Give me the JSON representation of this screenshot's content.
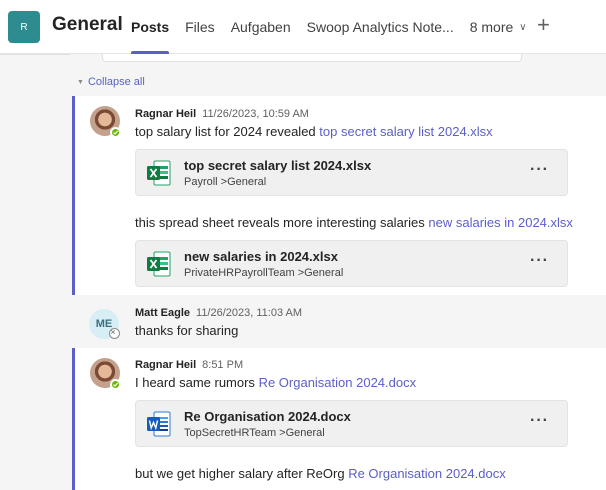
{
  "header": {
    "team_initial": "R",
    "channel_title": "General",
    "tabs": [
      {
        "label": "Posts"
      },
      {
        "label": "Files"
      },
      {
        "label": "Aufgaben"
      },
      {
        "label": "Swoop Analytics Note..."
      },
      {
        "label": "8 more"
      }
    ],
    "accent": "#5b5fc7"
  },
  "collapse_label": "Collapse all",
  "messages": [
    {
      "author": "Ragnar Heil",
      "time": "11/26/2023, 10:59 AM",
      "text": "top salary list for 2024 revealed",
      "link": "top secret salary list 2024.xlsx",
      "file": {
        "name": "top secret salary list 2024.xlsx",
        "path": "Payroll >General",
        "type": "excel-icon"
      },
      "reply_text": "this spread sheet reveals more interesting salaries",
      "reply_link": "new salaries in 2024.xlsx",
      "reply_file": {
        "name": "new salaries in 2024.xlsx",
        "path": "PrivateHRPayrollTeam >General",
        "type": "excel-icon"
      }
    },
    {
      "author": "Matt Eagle",
      "initials": "ME",
      "time": "11/26/2023, 11:03 AM",
      "text": "thanks for sharing"
    },
    {
      "author": "Ragnar Heil",
      "time": "8:51 PM",
      "text": "I heard same rumors",
      "link": "Re Organisation 2024.docx",
      "file": {
        "name": "Re Organisation 2024.docx",
        "path": "TopSecretHRTeam >General",
        "type": "word-icon"
      },
      "reply_text": "but we get higher salary after ReOrg",
      "reply_link": "Re Organisation 2024.docx"
    }
  ],
  "more_label": "···"
}
